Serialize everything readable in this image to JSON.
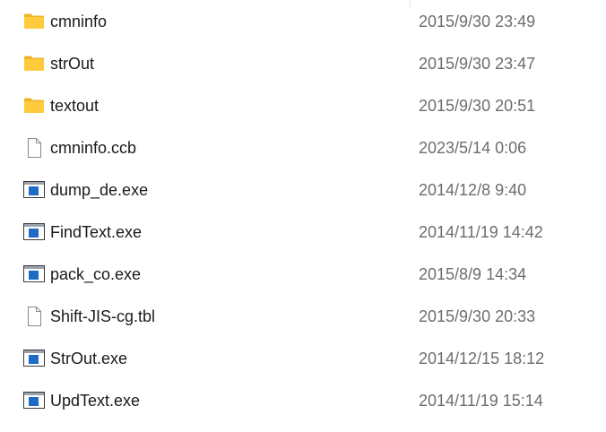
{
  "files": [
    {
      "name": "cmninfo",
      "modified": "2015/9/30 23:49",
      "icon": "folder-icon"
    },
    {
      "name": "strOut",
      "modified": "2015/9/30 23:47",
      "icon": "folder-icon"
    },
    {
      "name": "textout",
      "modified": "2015/9/30 20:51",
      "icon": "folder-icon"
    },
    {
      "name": "cmninfo.ccb",
      "modified": "2023/5/14 0:06",
      "icon": "document-icon"
    },
    {
      "name": "dump_de.exe",
      "modified": "2014/12/8 9:40",
      "icon": "application-icon"
    },
    {
      "name": "FindText.exe",
      "modified": "2014/11/19 14:42",
      "icon": "application-icon"
    },
    {
      "name": "pack_co.exe",
      "modified": "2015/8/9 14:34",
      "icon": "application-icon"
    },
    {
      "name": "Shift-JIS-cg.tbl",
      "modified": "2015/9/30 20:33",
      "icon": "document-icon"
    },
    {
      "name": "StrOut.exe",
      "modified": "2014/12/15 18:12",
      "icon": "application-icon"
    },
    {
      "name": "UpdText.exe",
      "modified": "2014/11/19 15:14",
      "icon": "application-icon"
    }
  ],
  "colors": {
    "folder": "#FFCB3D",
    "folder_tab": "#F0B429",
    "app_accent": "#1E6BC6",
    "document_stroke": "#8a8a8a"
  }
}
